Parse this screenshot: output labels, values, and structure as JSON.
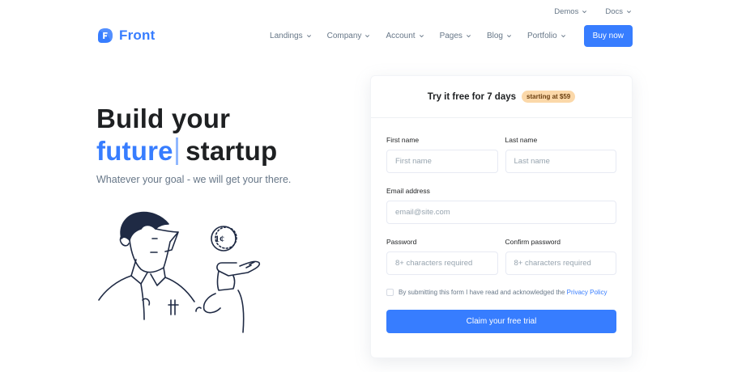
{
  "topbar": {
    "items": [
      {
        "label": "Demos"
      },
      {
        "label": "Docs"
      }
    ]
  },
  "header": {
    "logo_text": "Front",
    "nav": [
      {
        "label": "Landings"
      },
      {
        "label": "Company"
      },
      {
        "label": "Account"
      },
      {
        "label": "Pages"
      },
      {
        "label": "Blog"
      },
      {
        "label": "Portfolio"
      }
    ],
    "cta_label": "Buy now"
  },
  "hero": {
    "title_line1": "Build your",
    "title_accent": "future",
    "title_rest": "startup",
    "subtitle": "Whatever your goal - we will get your there.",
    "coin_label": "1¢"
  },
  "signup": {
    "title": "Try it free for 7 days",
    "badge": "starting at $59",
    "first_name": {
      "label": "First name",
      "placeholder": "First name"
    },
    "last_name": {
      "label": "Last name",
      "placeholder": "Last name"
    },
    "email": {
      "label": "Email address",
      "placeholder": "email@site.com"
    },
    "password": {
      "label": "Password",
      "placeholder": "8+ characters required"
    },
    "confirm_password": {
      "label": "Confirm password",
      "placeholder": "8+ characters required"
    },
    "terms_text": "By submitting this form I have read and acknowledged the ",
    "terms_link": "Privacy Policy",
    "submit_label": "Claim your free trial"
  },
  "colors": {
    "primary": "#377dff",
    "heading": "#1e2022",
    "muted": "#677788",
    "badge_bg": "#fbd8a9"
  }
}
